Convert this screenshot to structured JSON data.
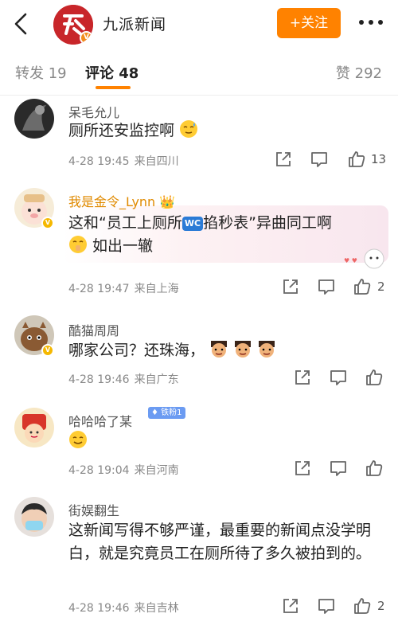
{
  "header": {
    "account_name": "九派新闻",
    "follow_label": "+关注"
  },
  "tabs": {
    "repost": "转发 19",
    "comment": "评论 48",
    "like": "赞 292"
  },
  "comments": [
    {
      "user": "呆毛允儿",
      "text": "厕所还安监控啊",
      "emoji": "sweat-smile",
      "time": "4-28 19:45",
      "location": "来自四川",
      "likes": "13"
    },
    {
      "user": "我是金令_Lynn",
      "crown": "👑",
      "text_before": "这和“员工上厕所",
      "wc": "WC",
      "text_after": "掐秒表”异曲同工啊",
      "text_line2": "如出一辙",
      "time": "4-28 19:47",
      "location": "来自上海",
      "likes": "2"
    },
    {
      "user": "酷猫周周",
      "text": "哪家公司？还珠海，",
      "time": "4-28 19:46",
      "location": "来自广东",
      "likes": ""
    },
    {
      "user": "哈哈哈了某",
      "badge": "铁粉1",
      "time": "4-28 19:04",
      "location": "来自河南",
      "likes": ""
    },
    {
      "user": "街娱翻生",
      "text": "这新闻写得不够严谨，最重要的新闻点没学明白，就是究竟员工在厕所待了多久被拍到的。",
      "time": "4-28 19:46",
      "location": "来自吉林",
      "likes": "2"
    }
  ],
  "colors": {
    "accent": "#ff8200",
    "brand_red": "#c8262a"
  }
}
